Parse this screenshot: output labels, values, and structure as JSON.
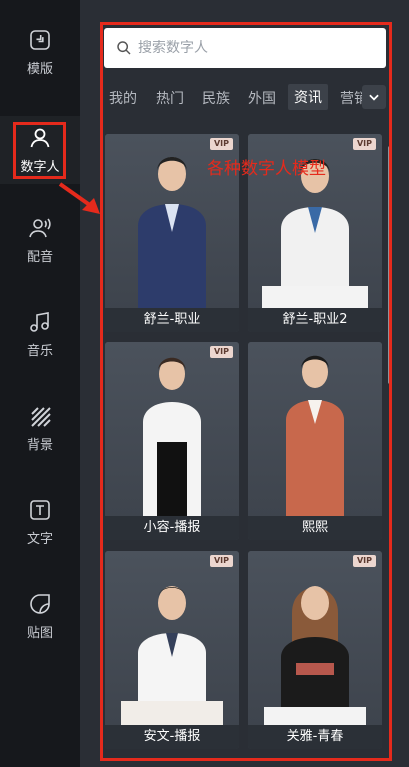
{
  "sidebar": {
    "items": [
      {
        "label": "模版",
        "icon": "template-icon"
      },
      {
        "label": "数字人",
        "icon": "person-icon"
      },
      {
        "label": "配音",
        "icon": "voice-icon"
      },
      {
        "label": "音乐",
        "icon": "music-note-icon"
      },
      {
        "label": "背景",
        "icon": "background-stripes-icon"
      },
      {
        "label": "文字",
        "icon": "text-icon"
      },
      {
        "label": "贴图",
        "icon": "sticker-icon"
      }
    ],
    "active": "数字人"
  },
  "search": {
    "placeholder": "搜索数字人"
  },
  "tabs": [
    "我的",
    "热门",
    "民族",
    "外国",
    "资讯",
    "营销"
  ],
  "active_tab": "资讯",
  "annotation": "各种数字人模型",
  "cards": [
    {
      "name": "舒兰-职业",
      "vip": "VIP"
    },
    {
      "name": "舒兰-职业2",
      "vip": "VIP"
    },
    {
      "name": "小容-播报",
      "vip": "VIP"
    },
    {
      "name": "熙熙",
      "vip": ""
    },
    {
      "name": "安文-播报",
      "vip": "VIP"
    },
    {
      "name": "关雅-青春",
      "vip": "VIP"
    }
  ],
  "colors": {
    "accent": "#e52a1c",
    "panel": "#2a2e35",
    "rail": "#16181c"
  }
}
